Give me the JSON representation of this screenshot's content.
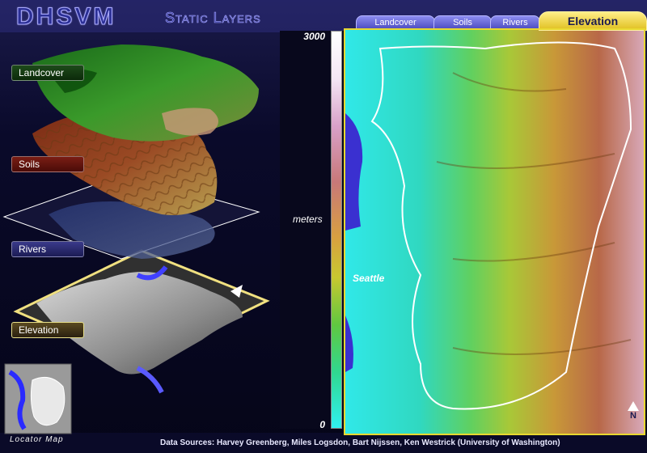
{
  "header": {
    "title": "DHSVM",
    "subtitle": "Static Layers"
  },
  "layers": {
    "landcover": "Landcover",
    "soils": "Soils",
    "rivers": "Rivers",
    "elevation": "Elevation"
  },
  "tabs": [
    "Landcover",
    "Soils",
    "Rivers",
    "Elevation"
  ],
  "active_tab": "Elevation",
  "scale": {
    "max": "3000",
    "min": "0",
    "unit": "meters"
  },
  "map": {
    "city": "Seattle",
    "north_label": "N"
  },
  "locator": {
    "label": "Locator Map"
  },
  "footer": {
    "credits": "Data Sources: Harvey Greenberg, Miles Logsdon, Bart Nijssen, Ken Westrick (University of Washington)"
  },
  "colors": {
    "accent": "#e8d830",
    "tab": "#6c6ce0",
    "background": "#070720"
  }
}
